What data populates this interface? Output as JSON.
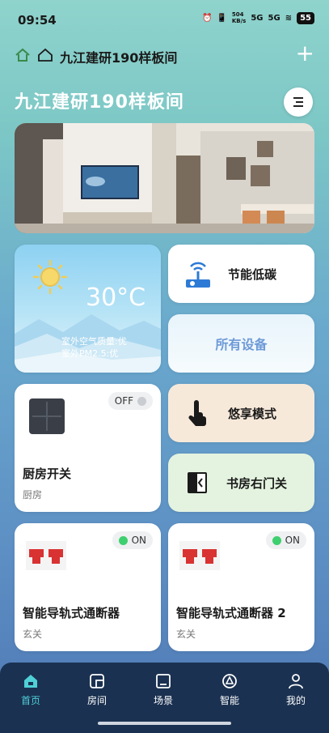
{
  "status_bar": {
    "time": "09:54",
    "speed": "504\nKB/s",
    "net1": "5G",
    "net2": "5G",
    "battery": "55"
  },
  "home_bar": {
    "home_name": "九江建研190样板间"
  },
  "page": {
    "title": "九江建研190样板间"
  },
  "weather": {
    "temperature": "30°C",
    "air_quality": "室外空气质量:优",
    "pm25": "室外PM2.5:优"
  },
  "features": {
    "energy": "节能低碳",
    "all_devices": "所有设备",
    "enjoy_mode": "悠享模式",
    "study_door": "书房右门关"
  },
  "devices": [
    {
      "name": "厨房开关",
      "room": "厨房",
      "state": "OFF"
    },
    {
      "name": "智能导轨式通断器",
      "room": "玄关",
      "state": "ON"
    },
    {
      "name": "智能导轨式通断器 2",
      "room": "玄关",
      "state": "ON"
    }
  ],
  "nav": [
    {
      "label": "首页",
      "icon": "home-icon"
    },
    {
      "label": "房间",
      "icon": "room-icon"
    },
    {
      "label": "场景",
      "icon": "scene-icon"
    },
    {
      "label": "智能",
      "icon": "smart-icon"
    },
    {
      "label": "我的",
      "icon": "profile-icon"
    }
  ],
  "colors": {
    "accent": "#4fd0d6",
    "on_green": "#3ecf6e",
    "nav_bg": "#1b3151",
    "enjoy_bg": "#f7e9da",
    "study_bg": "#e4f3e0"
  }
}
